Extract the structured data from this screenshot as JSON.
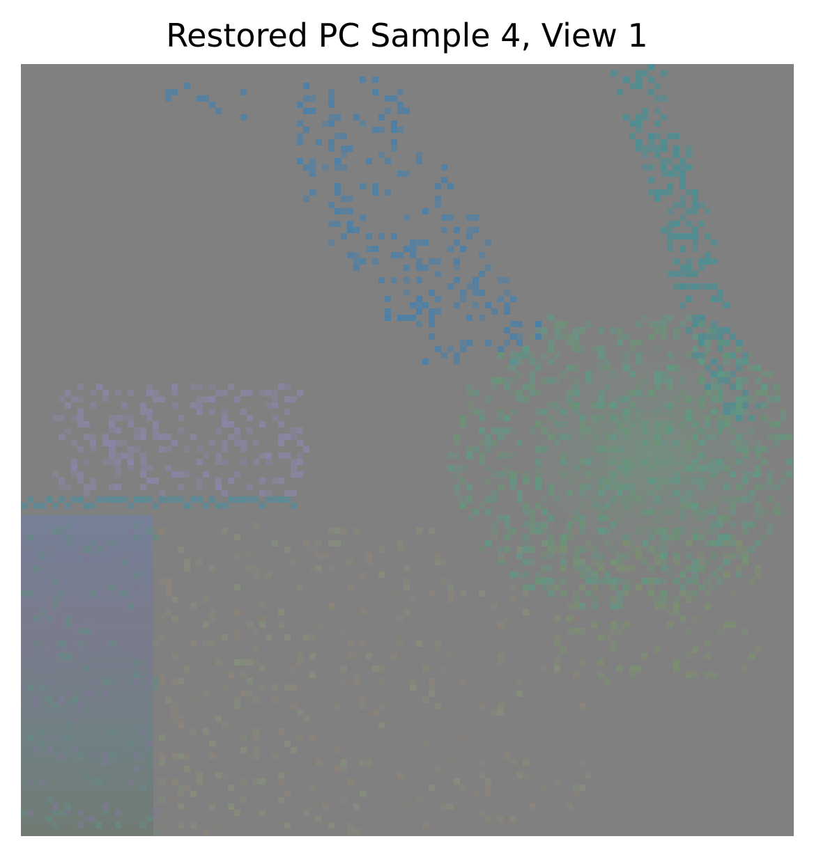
{
  "figure": {
    "title": "Restored PC Sample 4, View 1"
  },
  "image": {
    "description_colors": {
      "background": "#808080",
      "blue_cluster": "#4a7fa0",
      "teal_cluster": "#4f8f8f",
      "green_cluster": "#6b9a7c",
      "purple_cluster": "#8a8aa6",
      "olive_cluster": "#8a8c6c",
      "left_panel": "#6c7f8c"
    }
  }
}
